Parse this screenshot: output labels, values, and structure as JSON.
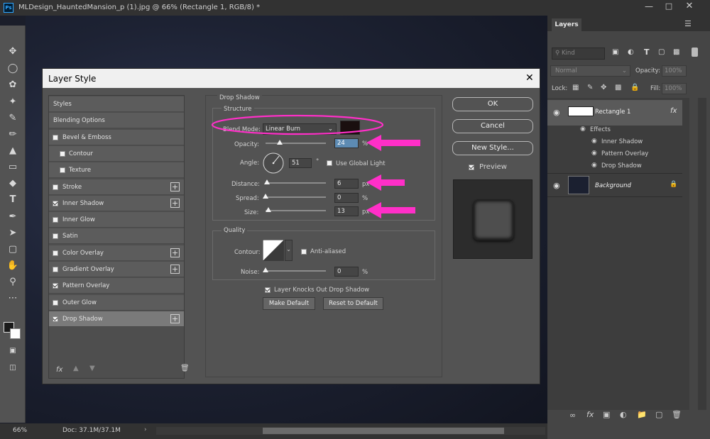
{
  "window": {
    "title": "MLDesign_HauntedMansion_p (1).jpg @ 66% (Rectangle 1, RGB/8) *"
  },
  "status": {
    "zoom": "66%",
    "doc": "Doc: 37.1M/37.1M"
  },
  "layers_panel": {
    "tab": "Layers",
    "filter_placeholder": "Kind",
    "blend": "Normal",
    "opacity_label": "Opacity:",
    "opacity_value": "100%",
    "lock_label": "Lock:",
    "fill_label": "Fill:",
    "fill_value": "100%",
    "layers": [
      {
        "name": "Rectangle 1",
        "effects_label": "Effects",
        "effects": [
          "Inner Shadow",
          "Pattern Overlay",
          "Drop Shadow"
        ]
      },
      {
        "name": "Background"
      }
    ]
  },
  "dialog": {
    "title": "Layer Style",
    "styles": [
      {
        "label": "Styles",
        "checkbox": false,
        "checked": false,
        "plus": false,
        "indent": false
      },
      {
        "label": "Blending Options",
        "checkbox": false,
        "checked": false,
        "plus": false,
        "indent": false
      },
      {
        "label": "Bevel & Emboss",
        "checkbox": true,
        "checked": false,
        "plus": false,
        "indent": false
      },
      {
        "label": "Contour",
        "checkbox": true,
        "checked": false,
        "plus": false,
        "indent": true
      },
      {
        "label": "Texture",
        "checkbox": true,
        "checked": false,
        "plus": false,
        "indent": true
      },
      {
        "label": "Stroke",
        "checkbox": true,
        "checked": false,
        "plus": true,
        "indent": false
      },
      {
        "label": "Inner Shadow",
        "checkbox": true,
        "checked": true,
        "plus": true,
        "indent": false
      },
      {
        "label": "Inner Glow",
        "checkbox": true,
        "checked": false,
        "plus": false,
        "indent": false
      },
      {
        "label": "Satin",
        "checkbox": true,
        "checked": false,
        "plus": false,
        "indent": false
      },
      {
        "label": "Color Overlay",
        "checkbox": true,
        "checked": false,
        "plus": true,
        "indent": false
      },
      {
        "label": "Gradient Overlay",
        "checkbox": true,
        "checked": false,
        "plus": true,
        "indent": false
      },
      {
        "label": "Pattern Overlay",
        "checkbox": true,
        "checked": true,
        "plus": false,
        "indent": false
      },
      {
        "label": "Outer Glow",
        "checkbox": true,
        "checked": false,
        "plus": false,
        "indent": false
      },
      {
        "label": "Drop Shadow",
        "checkbox": true,
        "checked": true,
        "plus": true,
        "indent": false,
        "selected": true
      }
    ],
    "section": "Drop Shadow",
    "structure": {
      "title": "Structure",
      "blend_mode_label": "Blend Mode:",
      "blend_mode_value": "Linear Burn",
      "shadow_color": "#1a0f0f",
      "opacity_label": "Opacity:",
      "opacity_value": "24",
      "opacity_unit": "%",
      "opacity_pct": 24,
      "angle_label": "Angle:",
      "angle_value": "51",
      "angle_unit": "°",
      "angle_deg": 51,
      "global_light_label": "Use Global Light",
      "distance_label": "Distance:",
      "distance_value": "6",
      "distance_unit": "px",
      "distance_pct": 2,
      "spread_label": "Spread:",
      "spread_value": "0",
      "spread_unit": "%",
      "spread_pct": 0,
      "size_label": "Size:",
      "size_value": "13",
      "size_unit": "px",
      "size_pct": 5
    },
    "quality": {
      "title": "Quality",
      "contour_label": "Contour:",
      "antialiased_label": "Anti-aliased",
      "noise_label": "Noise:",
      "noise_value": "0",
      "noise_unit": "%",
      "noise_pct": 0
    },
    "knockout_label": "Layer Knocks Out Drop Shadow",
    "make_default": "Make Default",
    "reset_default": "Reset to Default",
    "ok": "OK",
    "cancel": "Cancel",
    "new_style": "New Style...",
    "preview_label": "Preview"
  },
  "colors": {
    "annotation": "#ff2fc8",
    "foreground": "#1a1a1a",
    "background": "#ffffff"
  }
}
